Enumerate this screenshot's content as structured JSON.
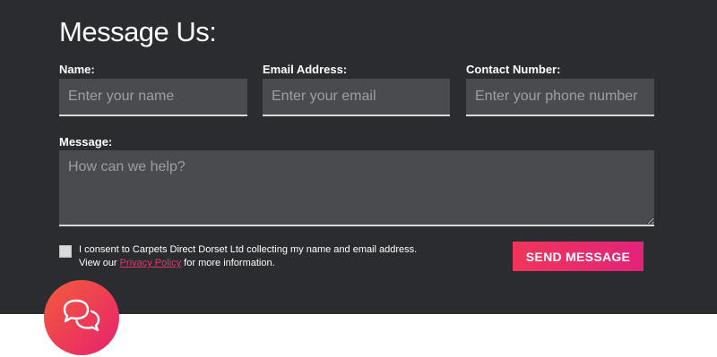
{
  "title": "Message Us:",
  "fields": {
    "name_label": "Name:",
    "name_placeholder": "Enter your name",
    "email_label": "Email Address:",
    "email_placeholder": "Enter your email",
    "phone_label": "Contact Number:",
    "phone_placeholder": "Enter your phone number",
    "message_label": "Message:",
    "message_placeholder": "How can we help?"
  },
  "consent": {
    "line1": "I consent to Carpets Direct Dorset Ltd collecting my name and email address.",
    "line2_prefix": "View our ",
    "link_text": "Privacy Policy",
    "line2_suffix": " for more information."
  },
  "send_label": "SEND MESSAGE",
  "icons": {
    "chat": "chat-bubbles-icon"
  },
  "colors": {
    "background": "#2a2c30",
    "accent": "#e8336e"
  }
}
